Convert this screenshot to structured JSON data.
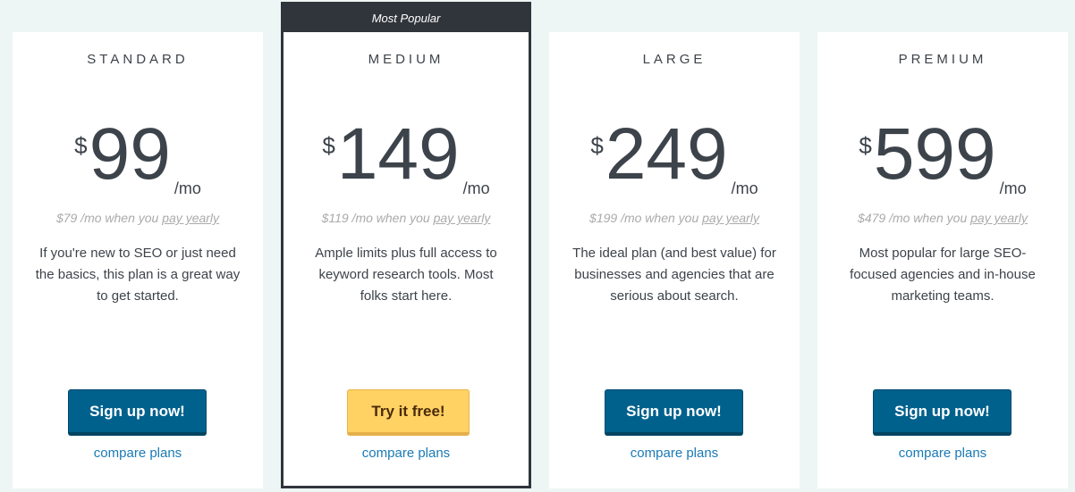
{
  "plans": [
    {
      "name": "STANDARD",
      "currency": "$",
      "price": "99",
      "period": "/mo",
      "yearly_prefix": "$79 /mo when you",
      "yearly_link": "pay yearly",
      "description": "If you're new to SEO or just need the basics, this plan is a great way to get started.",
      "button": "Sign up now!",
      "compare": "compare plans"
    },
    {
      "badge": "Most Popular",
      "name": "MEDIUM",
      "currency": "$",
      "price": "149",
      "period": "/mo",
      "yearly_prefix": "$119 /mo when you",
      "yearly_link": "pay yearly",
      "description": "Ample limits plus full access to keyword research tools. Most folks start here.",
      "button": "Try it free!",
      "compare": "compare plans"
    },
    {
      "name": "LARGE",
      "currency": "$",
      "price": "249",
      "period": "/mo",
      "yearly_prefix": "$199 /mo when you",
      "yearly_link": "pay yearly",
      "description": "The ideal plan (and best value) for businesses and agencies that are serious about search.",
      "button": "Sign up now!",
      "compare": "compare plans"
    },
    {
      "name": "PREMIUM",
      "currency": "$",
      "price": "599",
      "period": "/mo",
      "yearly_prefix": "$479 /mo when you",
      "yearly_link": "pay yearly",
      "description": "Most popular for large SEO-focused agencies and in-house marketing teams.",
      "button": "Sign up now!",
      "compare": "compare plans"
    }
  ],
  "colors": {
    "primary_button": "#00618d",
    "trial_button": "#ffd263",
    "popular_border": "#30353b",
    "link": "#1a7ab5"
  }
}
